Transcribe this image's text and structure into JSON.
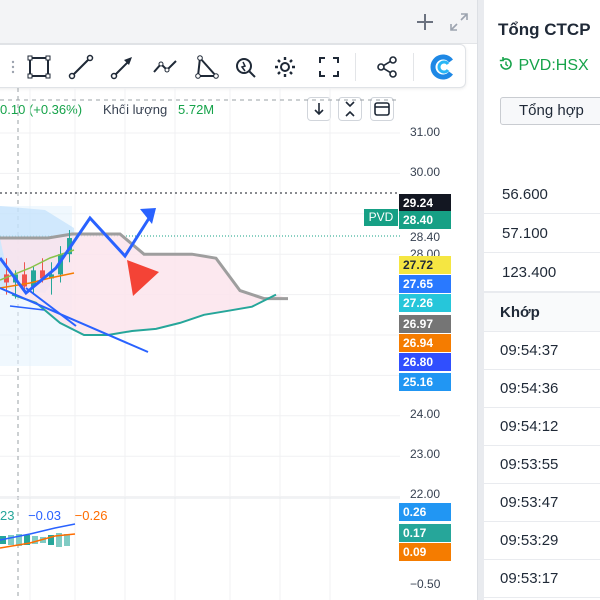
{
  "header": {
    "add_icon": "plus-icon",
    "expand_icon": "expand-icon"
  },
  "toolbar": {
    "tools": [
      {
        "name": "rectangle-tool",
        "icon": "rectangle-icon"
      },
      {
        "name": "line-tool",
        "icon": "line-icon"
      },
      {
        "name": "arrow-tool",
        "icon": "arrow-icon"
      },
      {
        "name": "path-tool",
        "icon": "polyline-icon"
      },
      {
        "name": "triangle-tool",
        "icon": "triangle-icon"
      },
      {
        "name": "magic-tool",
        "icon": "magic-wand-icon"
      },
      {
        "name": "settings-tool",
        "icon": "gear-icon"
      },
      {
        "name": "fullscreen-tool",
        "icon": "fullscreen-icon"
      },
      {
        "name": "share-tool",
        "icon": "share-icon"
      },
      {
        "name": "brand-tool",
        "icon": "brand-logo-icon"
      }
    ]
  },
  "legend": {
    "change": "0.10 (+0.36%)",
    "volume_label": "Khối lượng",
    "volume_value": "5.72M"
  },
  "mini_buttons": {
    "down_icon": "arrow-down-icon",
    "collapse_icon": "collapse-icon",
    "window_icon": "window-icon"
  },
  "price_axis": {
    "ticks": [
      "31.00",
      "30.00",
      "28.40",
      "28.00",
      "24.00",
      "23.00",
      "22.00"
    ],
    "tags": [
      {
        "label": "29.24",
        "color": "#131722"
      },
      {
        "label": "28.40",
        "color": "#16a085"
      },
      {
        "label": "27.72",
        "color": "#f5e642"
      },
      {
        "label": "27.65",
        "color": "#2979ff"
      },
      {
        "label": "27.26",
        "color": "#26c6da"
      },
      {
        "label": "26.97",
        "color": "#757575"
      },
      {
        "label": "26.94",
        "color": "#f57c00"
      },
      {
        "label": "26.80",
        "color": "#304ffe"
      },
      {
        "label": "25.16",
        "color": "#2196f3"
      }
    ],
    "symbol_tag": "PVD"
  },
  "oscillator": {
    "legend": [
      "23",
      "−0.03",
      "−0.26"
    ],
    "legend_colors": [
      "#26a69a",
      "#2962ff",
      "#ff6d00"
    ],
    "ticks": [
      "−0.50"
    ],
    "tags": [
      {
        "label": "0.26",
        "color": "#2196f3"
      },
      {
        "label": "0.17",
        "color": "#26a69a"
      },
      {
        "label": "0.09",
        "color": "#f57c00"
      }
    ]
  },
  "chart_data": {
    "type": "line",
    "title": "",
    "ylabel": "",
    "ylim": [
      22,
      31.5
    ],
    "current_price": 29.24,
    "levels": [
      28.4,
      27.72,
      27.65,
      27.26,
      26.97,
      26.94,
      26.8,
      25.16
    ],
    "series": [
      {
        "values": [
          28.4,
          28.4,
          28.4,
          28.5,
          28.5,
          28.5,
          28.0,
          28.0,
          28.0,
          27.9,
          27.1,
          26.9,
          26.9
        ]
      },
      {
        "values": [
          27.0,
          26.8,
          26.3,
          26.0,
          26.0,
          26.1,
          26.15,
          26.3,
          26.5,
          26.6,
          26.7,
          27.0
        ]
      }
    ],
    "candles": [
      {
        "o": 27.5,
        "h": 27.9,
        "l": 27.0,
        "c": 27.3
      },
      {
        "o": 27.3,
        "h": 27.6,
        "l": 26.9,
        "c": 27.5
      },
      {
        "o": 27.5,
        "h": 27.8,
        "l": 27.1,
        "c": 27.2
      },
      {
        "o": 27.2,
        "h": 27.7,
        "l": 27.0,
        "c": 27.6
      },
      {
        "o": 27.6,
        "h": 27.9,
        "l": 27.3,
        "c": 27.4
      },
      {
        "o": 27.4,
        "h": 27.8,
        "l": 27.0,
        "c": 27.5
      },
      {
        "o": 27.5,
        "h": 28.2,
        "l": 27.3,
        "c": 28.0
      },
      {
        "o": 28.0,
        "h": 28.6,
        "l": 27.8,
        "c": 28.4
      }
    ]
  },
  "right_panel": {
    "title": "Tổng CTCP",
    "symbol": "PVD:HSX",
    "symbol_icon": "refresh-clock-icon",
    "tab": "Tổng hợp",
    "stats": [
      "56.600",
      "57.100",
      "123.400"
    ],
    "match_header": "Khớp",
    "times": [
      "09:54:37",
      "09:54:36",
      "09:54:12",
      "09:53:55",
      "09:53:47",
      "09:53:29",
      "09:53:17"
    ]
  }
}
